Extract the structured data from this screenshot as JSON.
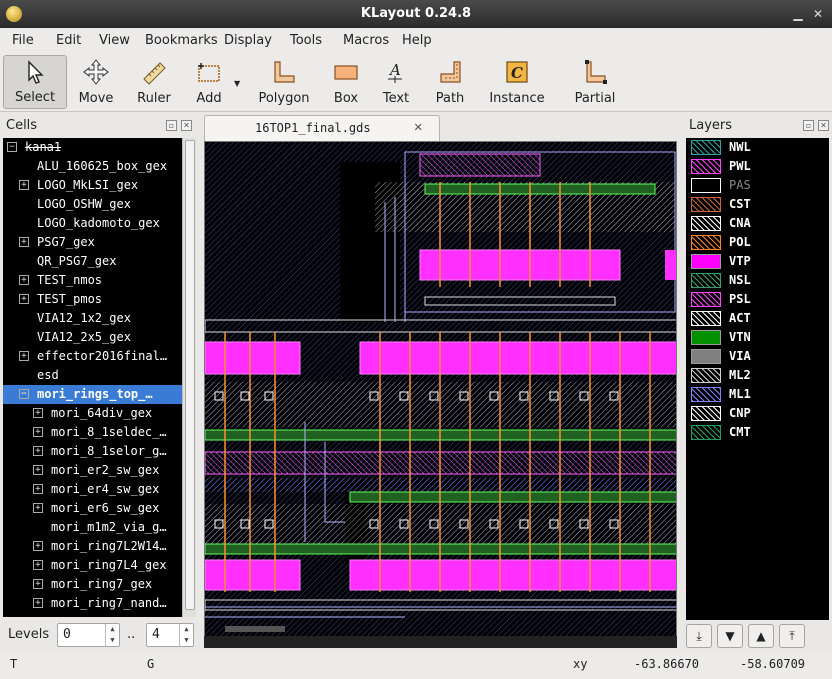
{
  "window": {
    "title": "KLayout 0.24.8"
  },
  "menu": [
    "File",
    "Edit",
    "View",
    "Bookmarks",
    "Display",
    "Tools",
    "Macros",
    "Help"
  ],
  "toolbar": {
    "select": "Select",
    "move": "Move",
    "ruler": "Ruler",
    "add": "Add",
    "polygon": "Polygon",
    "box": "Box",
    "text": "Text",
    "path": "Path",
    "instance": "Instance",
    "partial": "Partial"
  },
  "cells": {
    "title": "Cells",
    "items": [
      {
        "label": "kana1",
        "expander": "−"
      },
      {
        "label": "ALU_160625_box_gex",
        "expander": ""
      },
      {
        "label": "LOGO_MkLSI_gex",
        "expander": "+"
      },
      {
        "label": "LOGO_OSHW_gex",
        "expander": ""
      },
      {
        "label": "LOGO_kadomoto_gex",
        "expander": ""
      },
      {
        "label": "PSG7_gex",
        "expander": "+"
      },
      {
        "label": "QR_PSG7_gex",
        "expander": ""
      },
      {
        "label": "TEST_nmos",
        "expander": "+"
      },
      {
        "label": "TEST_pmos",
        "expander": "+"
      },
      {
        "label": "VIA12_1x2_gex",
        "expander": ""
      },
      {
        "label": "VIA12_2x5_gex",
        "expander": ""
      },
      {
        "label": "effector2016final…",
        "expander": "+"
      },
      {
        "label": "esd",
        "expander": ""
      },
      {
        "label": "mori_rings_top_…",
        "expander": "−"
      },
      {
        "label": "mori_64div_gex",
        "expander": "+"
      },
      {
        "label": "mori_8_1seldec_…",
        "expander": "+"
      },
      {
        "label": "mori_8_1selor_g…",
        "expander": "+"
      },
      {
        "label": "mori_er2_sw_gex",
        "expander": "+"
      },
      {
        "label": "mori_er4_sw_gex",
        "expander": "+"
      },
      {
        "label": "mori_er6_sw_gex",
        "expander": "+"
      },
      {
        "label": "mori_m1m2_via_g…",
        "expander": ""
      },
      {
        "label": "mori_ring7L2W14…",
        "expander": "+"
      },
      {
        "label": "mori_ring7L4_gex",
        "expander": "+"
      },
      {
        "label": "mori_ring7_gex",
        "expander": "+"
      },
      {
        "label": "mori_ring7_nand…",
        "expander": "+"
      }
    ]
  },
  "levels": {
    "label": "Levels",
    "from": "0",
    "sep": "..",
    "to": "4"
  },
  "tab": {
    "label": "16TOP1_final.gds"
  },
  "layers": {
    "title": "Layers",
    "items": [
      {
        "name": "NWL",
        "color": "#2aa3a3"
      },
      {
        "name": "PWL",
        "color": "#ff44ff"
      },
      {
        "name": "PAS",
        "color": "#ffffff"
      },
      {
        "name": "CST",
        "color": "#c86432"
      },
      {
        "name": "CNA",
        "color": "#ffffff"
      },
      {
        "name": "POL",
        "color": "#ff8020"
      },
      {
        "name": "VTP",
        "color": "#ff00ff"
      },
      {
        "name": "NSL",
        "color": "#30a070"
      },
      {
        "name": "PSL",
        "color": "#ff40ff"
      },
      {
        "name": "ACT",
        "color": "#ffffff"
      },
      {
        "name": "VTN",
        "color": "#009000"
      },
      {
        "name": "VIA",
        "color": "#808080"
      },
      {
        "name": "ML2",
        "color": "#d0d0d0"
      },
      {
        "name": "ML1",
        "color": "#8080ff"
      },
      {
        "name": "CNP",
        "color": "#ffffff"
      },
      {
        "name": "CMT",
        "color": "#20a060"
      }
    ]
  },
  "status": {
    "t": "T",
    "g": "G",
    "xy_label": "xy",
    "x": "-63.86670",
    "y": "-58.60709"
  }
}
